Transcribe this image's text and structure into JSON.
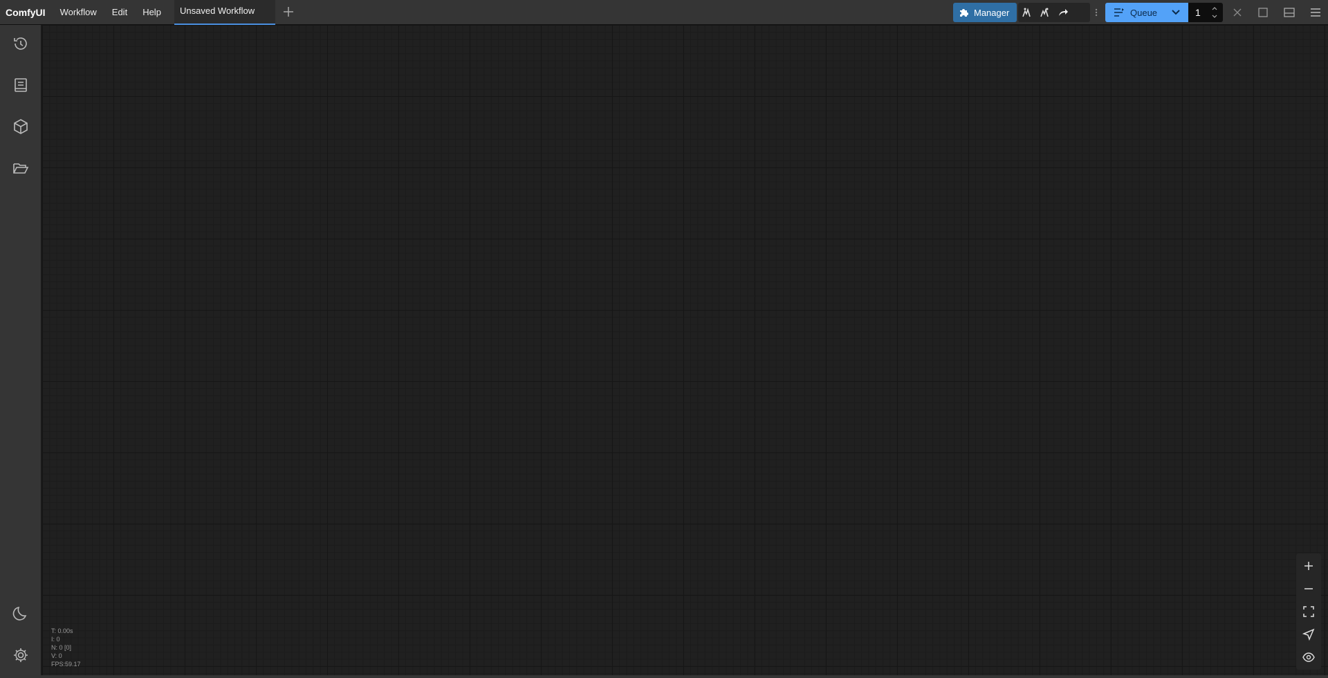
{
  "app": {
    "name": "ComfyUI"
  },
  "menu": {
    "items": [
      "Workflow",
      "Edit",
      "Help"
    ]
  },
  "tabs": [
    {
      "label": "Unsaved Workflow",
      "active": true
    }
  ],
  "toolbar": {
    "manager_label": "Manager",
    "queue_label": "Queue",
    "queue_count": "1"
  },
  "sidebar": {
    "items": [
      {
        "icon": "history-icon"
      },
      {
        "icon": "book-icon"
      },
      {
        "icon": "cube-icon"
      },
      {
        "icon": "folder-open-icon"
      }
    ],
    "bottom": [
      {
        "icon": "moon-icon"
      },
      {
        "icon": "gear-icon"
      }
    ]
  },
  "stats": {
    "t": "T: 0.00s",
    "i": "I: 0",
    "n": "N: 0 [0]",
    "v": "V: 0",
    "fps": "FPS:59.17"
  },
  "colors": {
    "accent": "#53a2f8",
    "manager": "#2f6fa5",
    "tab_underline": "#4a90e2",
    "canvas": "#202020"
  }
}
